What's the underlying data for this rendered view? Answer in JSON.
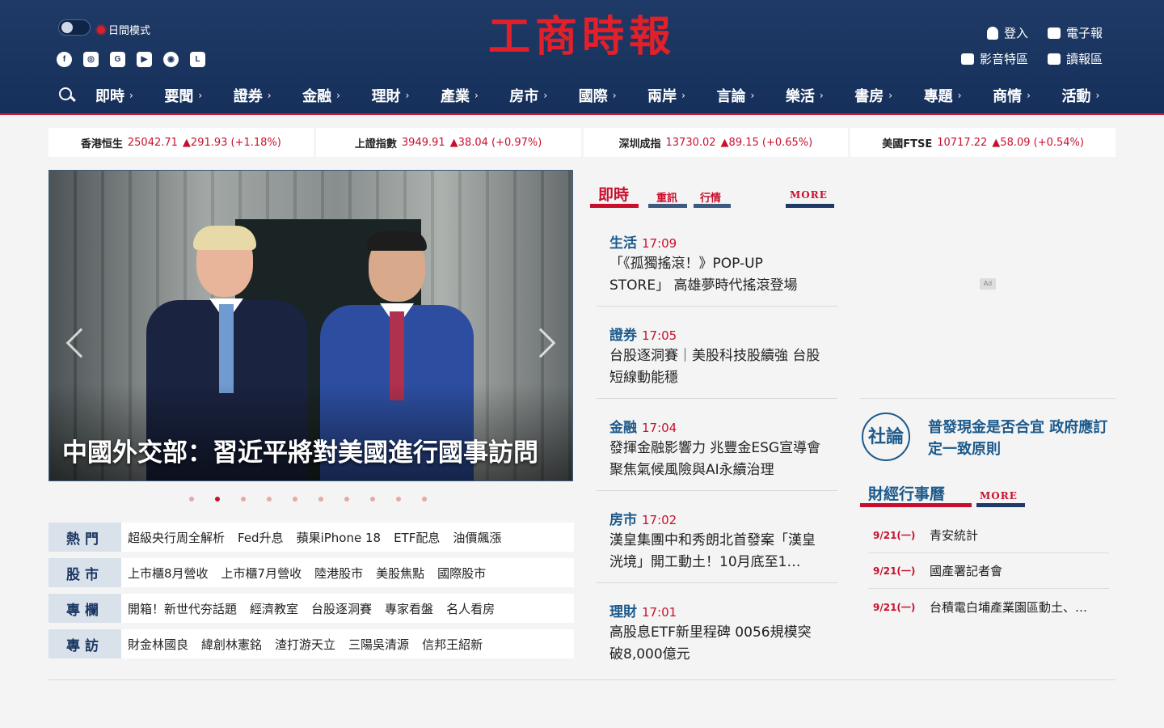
{
  "header": {
    "mode_label": "日間模式",
    "logo_text": "工商時報",
    "socials": [
      "facebook-icon",
      "instagram-icon",
      "news-icon",
      "youtube-icon",
      "podcast-icon",
      "line-icon"
    ],
    "login": "登入",
    "epaper": "電子報",
    "video": "影音特區",
    "reading": "讀報區"
  },
  "nav": [
    "即時",
    "要聞",
    "證券",
    "金融",
    "理財",
    "產業",
    "房市",
    "國際",
    "兩岸",
    "言論",
    "樂活",
    "書房",
    "專題",
    "商情",
    "活動"
  ],
  "ticker": [
    {
      "name": "香港恒生",
      "value": "25042.71",
      "change": "▲291.93 (+1.18%)"
    },
    {
      "name": "上證指數",
      "value": "3949.91",
      "change": "▲38.04 (+0.97%)"
    },
    {
      "name": "深圳成指",
      "value": "13730.02",
      "change": "▲89.15 (+0.65%)"
    },
    {
      "name": "美國FTSE",
      "value": "10717.22",
      "change": "▲58.09 (+0.54%)"
    }
  ],
  "hero": {
    "caption": "中國外交部：習近平將對美國進行國事訪問",
    "slide_count": 10,
    "active_slide": 2
  },
  "topics": [
    {
      "label": "熱門",
      "items": [
        "超級央行周全解析",
        "Fed升息",
        "蘋果iPhone 18",
        "ETF配息",
        "油價飆漲"
      ]
    },
    {
      "label": "股市",
      "items": [
        "上市櫃8月營收",
        "上市櫃7月營收",
        "陸港股市",
        "美股焦點",
        "國際股市"
      ]
    },
    {
      "label": "專欄",
      "items": [
        "開箱！新世代夯話題",
        "經濟教室",
        "台股逐洞賽",
        "專家看盤",
        "名人看房"
      ]
    },
    {
      "label": "專訪",
      "items": [
        "財金林國良",
        "緯創林憲銘",
        "渣打游天立",
        "三陽吳清源",
        "信邦王紹新"
      ]
    }
  ],
  "realtime": {
    "tab_main": "即時",
    "tab_major": "重訊",
    "tab_market": "行情",
    "more": "MORE",
    "news": [
      {
        "cat": "生活",
        "time": "17:09",
        "title": "「《孤獨搖滾！》POP-UP STORE」 高雄夢時代搖滾登場"
      },
      {
        "cat": "證券",
        "time": "17:05",
        "title": "台股逐洞賽｜美股科技股續強 台股短線動能穩"
      },
      {
        "cat": "金融",
        "time": "17:04",
        "title": "發揮金融影響力 兆豐金ESG宣導會聚焦氣候風險與AI永續治理"
      },
      {
        "cat": "房市",
        "time": "17:02",
        "title": "漢皇集團中和秀朗北首發案「漢皇洸境」開工動土！10月底至1…"
      },
      {
        "cat": "理財",
        "time": "17:01",
        "title": "高股息ETF新里程碑 0056規模突破8,000億元"
      }
    ]
  },
  "editorial": {
    "seal": "社論",
    "title": "普發現金是否合宜 政府應訂定一致原則"
  },
  "calendar": {
    "title": "財經行事曆",
    "more": "MORE",
    "events": [
      {
        "date": "9/21(一)",
        "event": "青安統計"
      },
      {
        "date": "9/21(一)",
        "event": "國產署記者會"
      },
      {
        "date": "9/21(一)",
        "event": "台積電白埔產業園區動土、…"
      }
    ]
  },
  "ad_label": "Ad",
  "colors": {
    "brand_navy": "#1f3a66",
    "accent_red": "#c8102e",
    "link_blue": "#1c5a8c"
  }
}
